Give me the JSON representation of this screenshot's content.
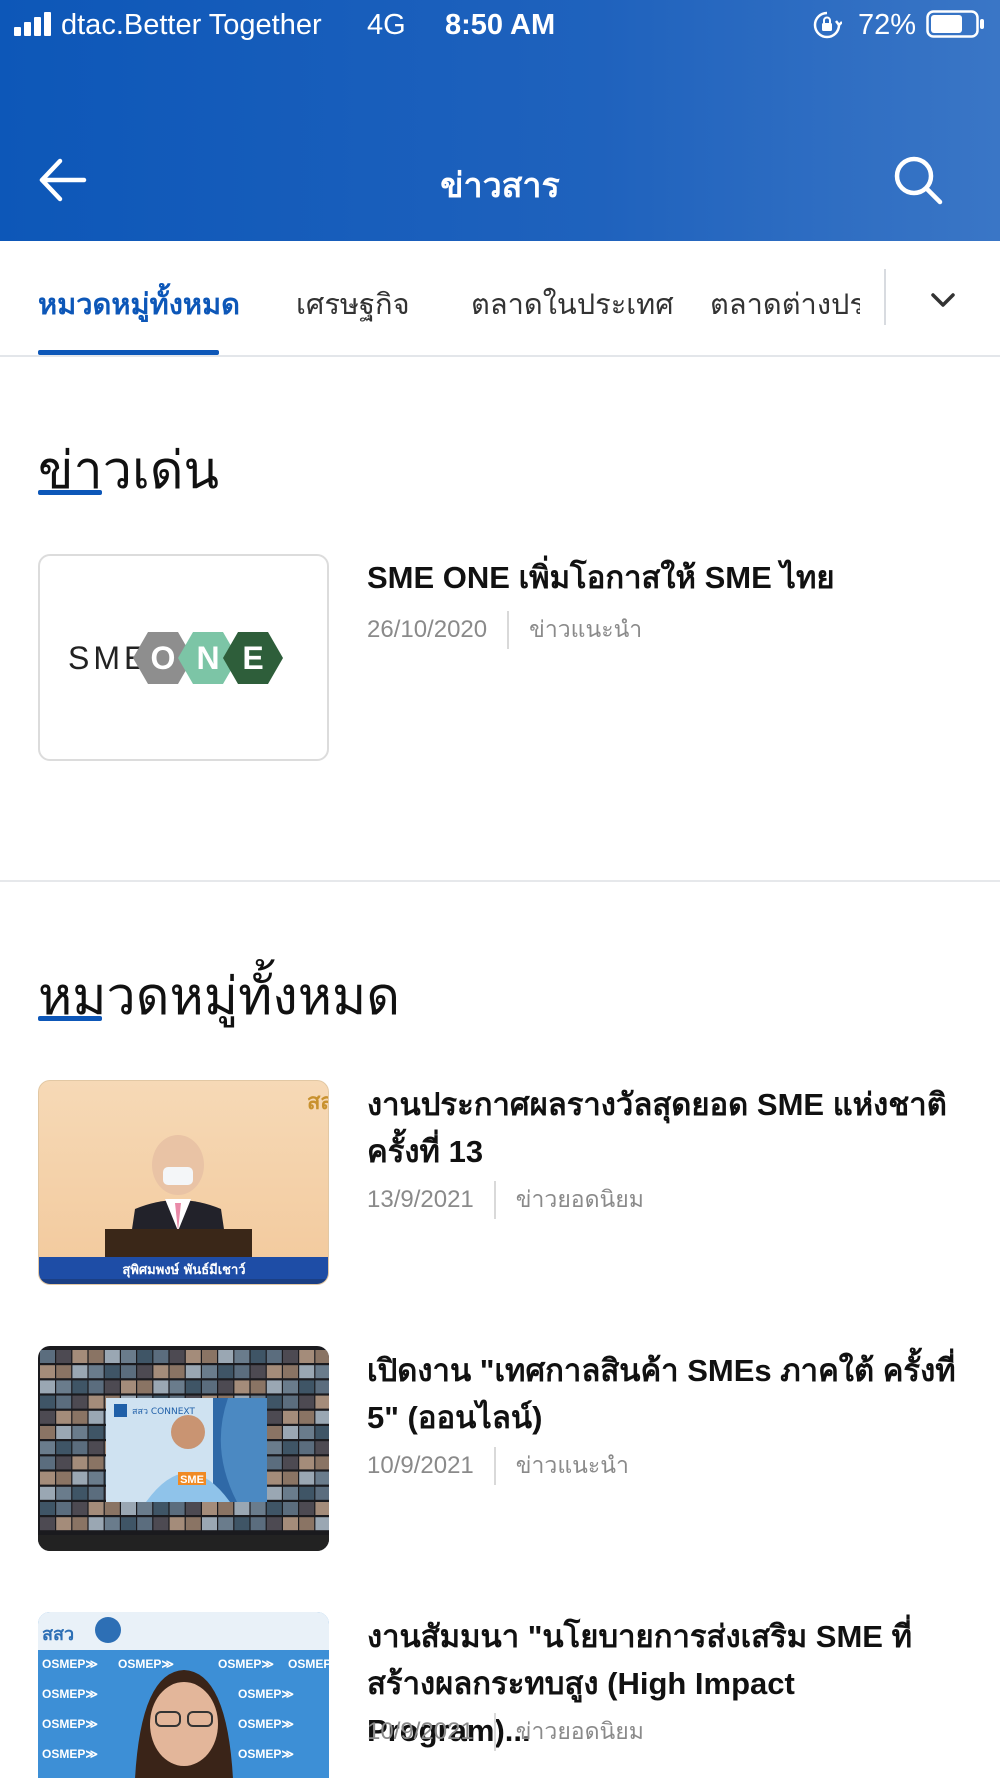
{
  "status_bar": {
    "carrier": "dtac.Better Together",
    "network": "4G",
    "time": "8:50 AM",
    "battery": "72%",
    "battery_level": 0.72
  },
  "header": {
    "title": "ข่าวสาร",
    "back_icon": "arrow-left-icon",
    "search_icon": "search-icon",
    "background_color": "#0d57b8"
  },
  "tabs": [
    {
      "label": "หมวดหมู่ทั้งหมด",
      "active": true
    },
    {
      "label": "เศรษฐกิจ",
      "active": false
    },
    {
      "label": "ตลาดในประเทศ",
      "active": false
    },
    {
      "label": "ตลาดต่างประเทศ",
      "active": false
    }
  ],
  "featured": {
    "title": "ข่าวเด่น",
    "item": {
      "title": "SME ONE เพิ่มโอกาสให้ SME ไทย",
      "date": "26/10/2020",
      "category": "ข่าวแนะนำ",
      "logo": {
        "prefix": "SME",
        "letters": [
          "O",
          "N",
          "E"
        ],
        "colors": [
          "#8e8e8e",
          "#7cc5a6",
          "#2e5e3a"
        ]
      }
    }
  },
  "all_news": {
    "title": "หมวดหมู่ทั้งหมด",
    "items": [
      {
        "title": "งานประกาศผลรางวัลสุดยอด SME แห่งชาติ ครั้งที่ 13",
        "date": "13/9/2021",
        "category": "ข่าวยอดนิยม",
        "caption": "สุพิศมพงษ์ พันธ์มีเชาว์",
        "corner_text": "สส"
      },
      {
        "title": "เปิดงาน \"เทศกาลสินค้า SMEs ภาคใต้ ครั้งที่ 5\" (ออนไลน์)",
        "date": "10/9/2021",
        "category": "ข่าวแนะนำ",
        "badge": "SME",
        "logo_text": "สสว CONNEXT"
      },
      {
        "title": "งานสัมมนา \"นโยบายการส่งเสริม SME ที่สร้างผลกระทบสูง (High Impact Program)...",
        "date": "10/9/2021",
        "category": "ข่าวยอดนิยม",
        "backdrop_text": "OSMEP≫",
        "banner_text": "สสว"
      }
    ]
  },
  "colors": {
    "accent": "#0d57b8",
    "meta_text": "#8a8a8a"
  }
}
